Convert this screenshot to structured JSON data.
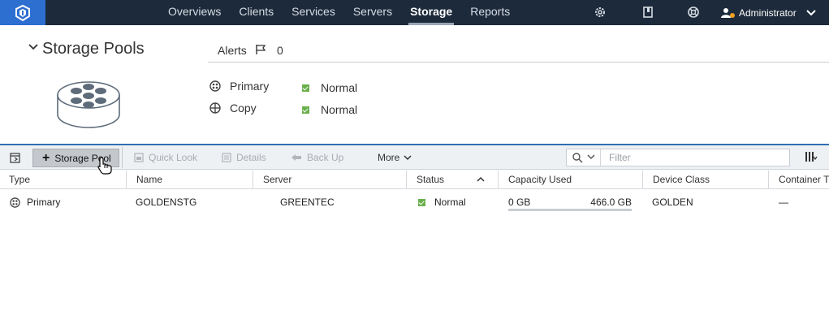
{
  "nav": {
    "items": [
      {
        "label": "Overviews"
      },
      {
        "label": "Clients"
      },
      {
        "label": "Services"
      },
      {
        "label": "Servers"
      },
      {
        "label": "Storage"
      },
      {
        "label": "Reports"
      }
    ],
    "active": "Storage",
    "user": "Administrator",
    "icons": [
      "settings-icon",
      "book-icon",
      "help-icon",
      "user-icon"
    ]
  },
  "header": {
    "title": "Storage Pools",
    "alerts_label": "Alerts",
    "alerts_count": "0"
  },
  "summary": {
    "types": [
      {
        "label": "Primary",
        "status": "Normal"
      },
      {
        "label": "Copy",
        "status": "Normal"
      }
    ]
  },
  "toolbar": {
    "add_label": "Storage Pool",
    "quick_look": "Quick Look",
    "details": "Details",
    "back_up": "Back Up",
    "more": "More",
    "filter_placeholder": "Filter"
  },
  "table": {
    "columns": [
      "Type",
      "Name",
      "Server",
      "Status",
      "Capacity Used",
      "Device Class",
      "Container Typ"
    ],
    "rows": [
      {
        "type": "Primary",
        "name": "GOLDENSTG",
        "server": "GREENTEC",
        "status": "Normal",
        "capacity_used": "0 GB",
        "capacity_total": "466.0 GB",
        "capacity_fraction": 0,
        "device_class": "GOLDEN",
        "container_type": "—"
      }
    ]
  },
  "colors": {
    "nav_bg": "#1d2a3b",
    "logo_bg": "#2d6fd0",
    "status_normal": "#6ab04c",
    "toolbar_accent": "#2f6fb3"
  }
}
